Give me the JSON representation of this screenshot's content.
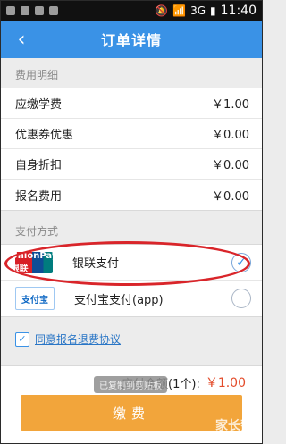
{
  "status_bar": {
    "time": "11:40",
    "network": "3G"
  },
  "header": {
    "title": "订单详情"
  },
  "fees": {
    "section_title": "费用明细",
    "items": [
      {
        "label": "应缴学费",
        "amount": "￥1.00"
      },
      {
        "label": "优惠券优惠",
        "amount": "￥0.00"
      },
      {
        "label": "自身折扣",
        "amount": "￥0.00"
      },
      {
        "label": "报名费用",
        "amount": "￥0.00"
      }
    ]
  },
  "payment": {
    "section_title": "支付方式",
    "methods": [
      {
        "label": "银联支付",
        "logo_text": "UnionPay 银联",
        "selected": true
      },
      {
        "label": "支付宝支付(app)",
        "logo_text": "支付宝",
        "selected": false
      }
    ]
  },
  "agreement": {
    "text": "同意报名退费协议",
    "checked": true
  },
  "footer": {
    "total_label": "应付金额(1个):",
    "total_value": "￥1.00",
    "pay_button": "缴费",
    "toast": "已复制到剪贴板",
    "watermark": "家长帮"
  }
}
